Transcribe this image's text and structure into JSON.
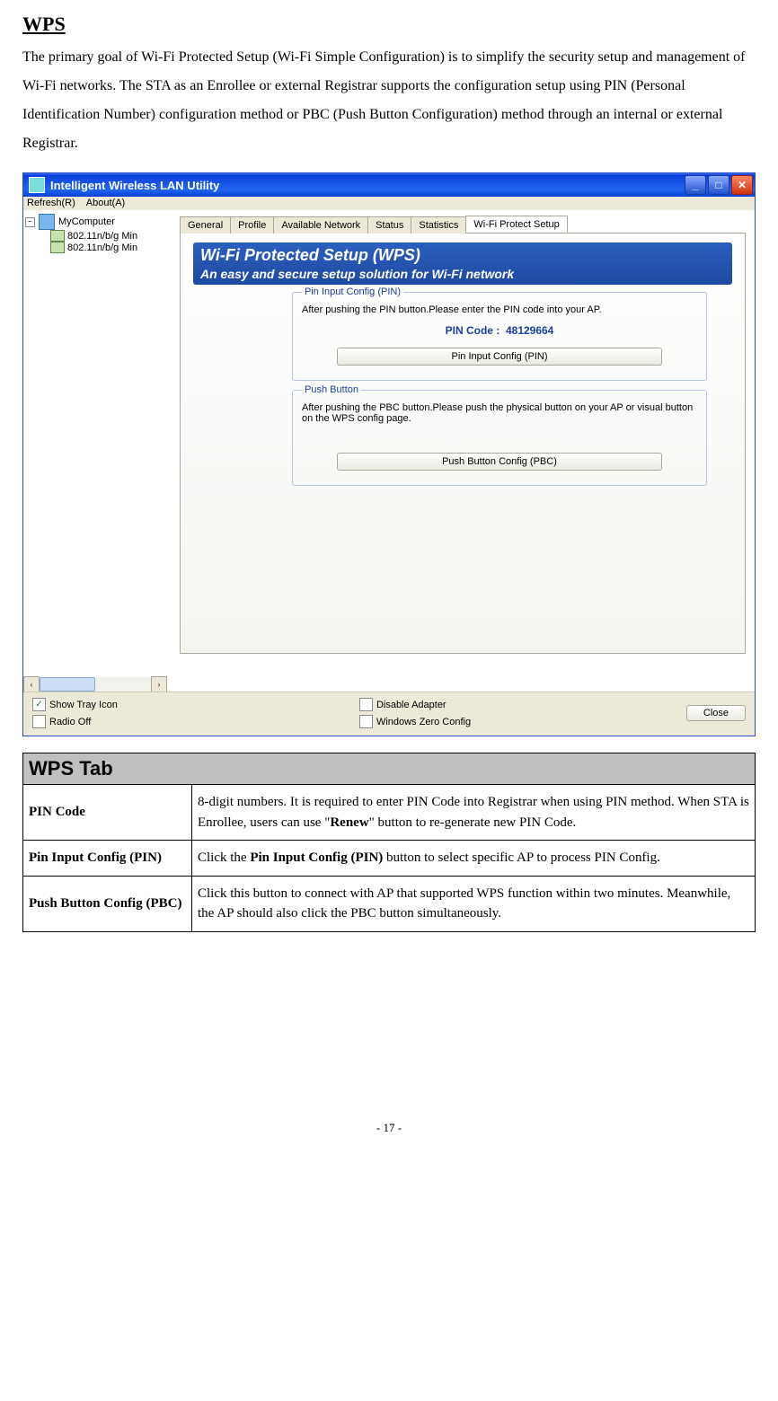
{
  "section_title": "WPS",
  "intro_paragraph": "The primary goal of Wi-Fi Protected Setup (Wi-Fi Simple Configuration) is to simplify the security setup and management of Wi-Fi networks. The STA as an Enrollee or external Registrar supports the configuration setup using PIN (Personal Identification Number) configuration method or PBC (Push Button Configuration) method through an internal or external Registrar.",
  "window": {
    "title": "Intelligent Wireless LAN Utility",
    "menu": {
      "refresh": "Refresh(R)",
      "about": "About(A)"
    },
    "tree": {
      "root": "MyComputer",
      "children": [
        "802.11n/b/g Min",
        "802.11n/b/g Min"
      ]
    },
    "tabs": [
      "General",
      "Profile",
      "Available Network",
      "Status",
      "Statistics",
      "Wi-Fi Protect Setup"
    ],
    "active_tab": 5,
    "banner": {
      "line1": "Wi-Fi Protected Setup (WPS)",
      "line2": "An easy and secure setup solution for Wi-Fi network"
    },
    "pin_group": {
      "legend": "Pin Input Config (PIN)",
      "hint": "After pushing the PIN button.Please enter the PIN code into your AP.",
      "pin_label": "PIN Code :",
      "pin_value": "48129664",
      "button": "Pin Input Config (PIN)"
    },
    "pbc_group": {
      "legend": "Push Button",
      "hint": "After pushing the PBC button.Please push the physical button on your AP or visual button on the WPS config page.",
      "button": "Push Button Config (PBC)"
    },
    "bottom": {
      "show_tray": "Show Tray Icon",
      "radio_off": "Radio Off",
      "disable_adapter": "Disable Adapter",
      "win_zero": "Windows Zero Config",
      "close": "Close"
    }
  },
  "table": {
    "header": "WPS Tab",
    "rows": [
      {
        "key": "PIN Code",
        "val_pre": "8-digit numbers. It is required to enter PIN Code into Registrar when using PIN method. When STA is Enrollee, users can use \"",
        "val_bold": "Renew",
        "val_post": "\" button to re-generate new PIN Code."
      },
      {
        "key": "Pin Input Config (PIN)",
        "val_pre": "Click the ",
        "val_bold": "Pin Input Config (PIN)",
        "val_post": " button to select specific AP to process PIN Config."
      },
      {
        "key": "Push Button Config (PBC)",
        "val_pre": "Click this button to connect with AP that supported WPS function within two minutes. Meanwhile, the AP should also click the PBC button simultaneously.",
        "val_bold": "",
        "val_post": ""
      }
    ]
  },
  "page_number": "- 17 -"
}
